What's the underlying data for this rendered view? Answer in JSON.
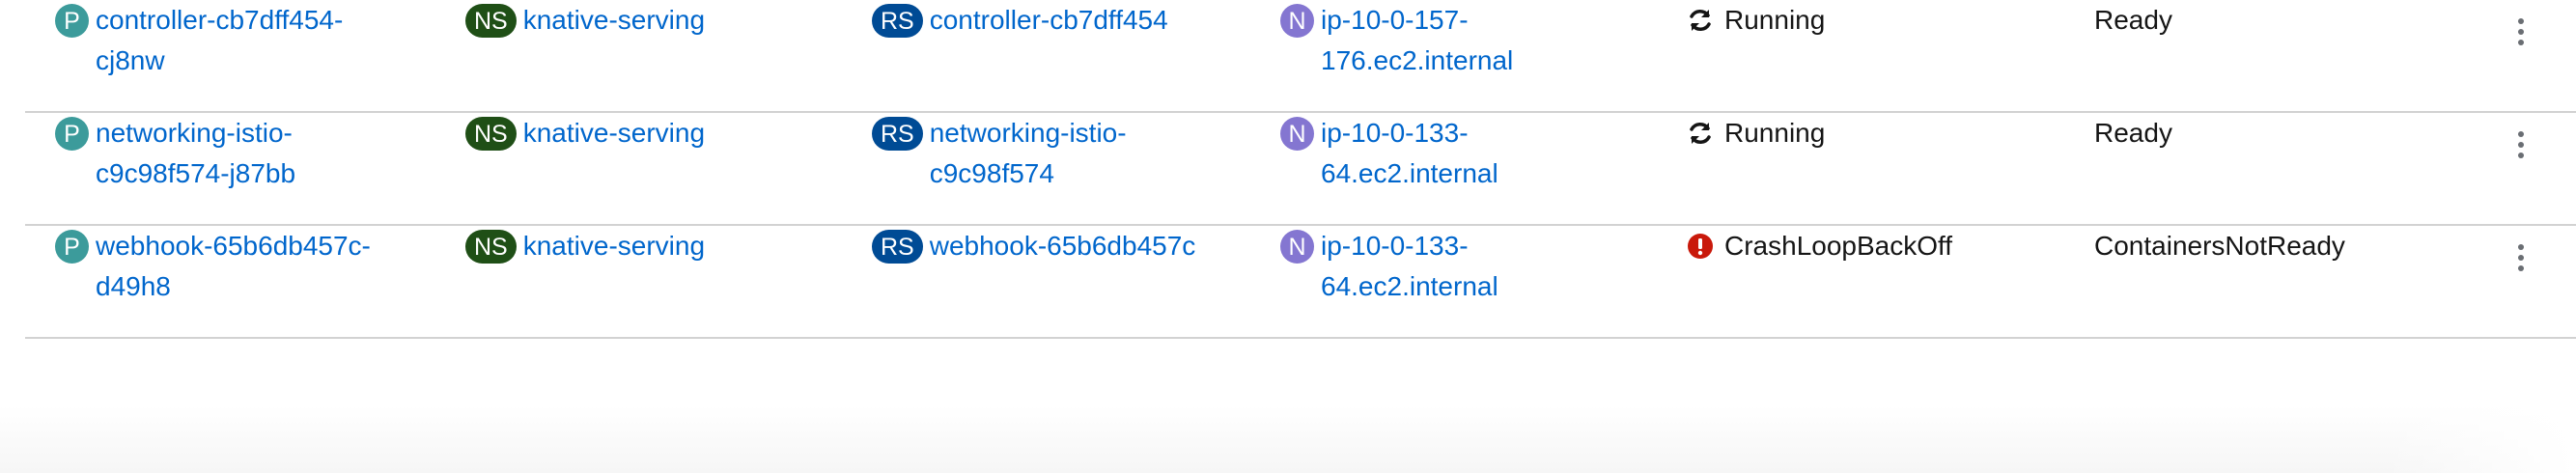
{
  "rows": [
    {
      "pod": {
        "badge": "P",
        "name": "controller-cb7dff454-\ncj8nw"
      },
      "namespace": {
        "badge": "NS",
        "name": "knative-serving"
      },
      "replicaset": {
        "badge": "RS",
        "name": "controller-cb7dff454"
      },
      "node": {
        "badge": "N",
        "name": "ip-10-0-157-\n176.ec2.internal"
      },
      "status": {
        "icon": "sync-icon",
        "text": "Running"
      },
      "readiness": "Ready"
    },
    {
      "pod": {
        "badge": "P",
        "name": "networking-istio-\nc9c98f574-j87bb"
      },
      "namespace": {
        "badge": "NS",
        "name": "knative-serving"
      },
      "replicaset": {
        "badge": "RS",
        "name": "networking-istio-\nc9c98f574"
      },
      "node": {
        "badge": "N",
        "name": "ip-10-0-133-\n64.ec2.internal"
      },
      "status": {
        "icon": "sync-icon",
        "text": "Running"
      },
      "readiness": "Ready"
    },
    {
      "pod": {
        "badge": "P",
        "name": "webhook-65b6db457c-\nd49h8"
      },
      "namespace": {
        "badge": "NS",
        "name": "knative-serving"
      },
      "replicaset": {
        "badge": "RS",
        "name": "webhook-65b6db457c"
      },
      "node": {
        "badge": "N",
        "name": "ip-10-0-133-\n64.ec2.internal"
      },
      "status": {
        "icon": "error-circle-icon",
        "text": "CrashLoopBackOff"
      },
      "readiness": "ContainersNotReady"
    }
  ],
  "colors": {
    "link": "#0066cc",
    "pod_badge": "#3c9b9b",
    "namespace_badge": "#1f4f16",
    "replicaset_badge": "#004b95",
    "node_badge": "#8476d1",
    "error": "#c9190b"
  }
}
